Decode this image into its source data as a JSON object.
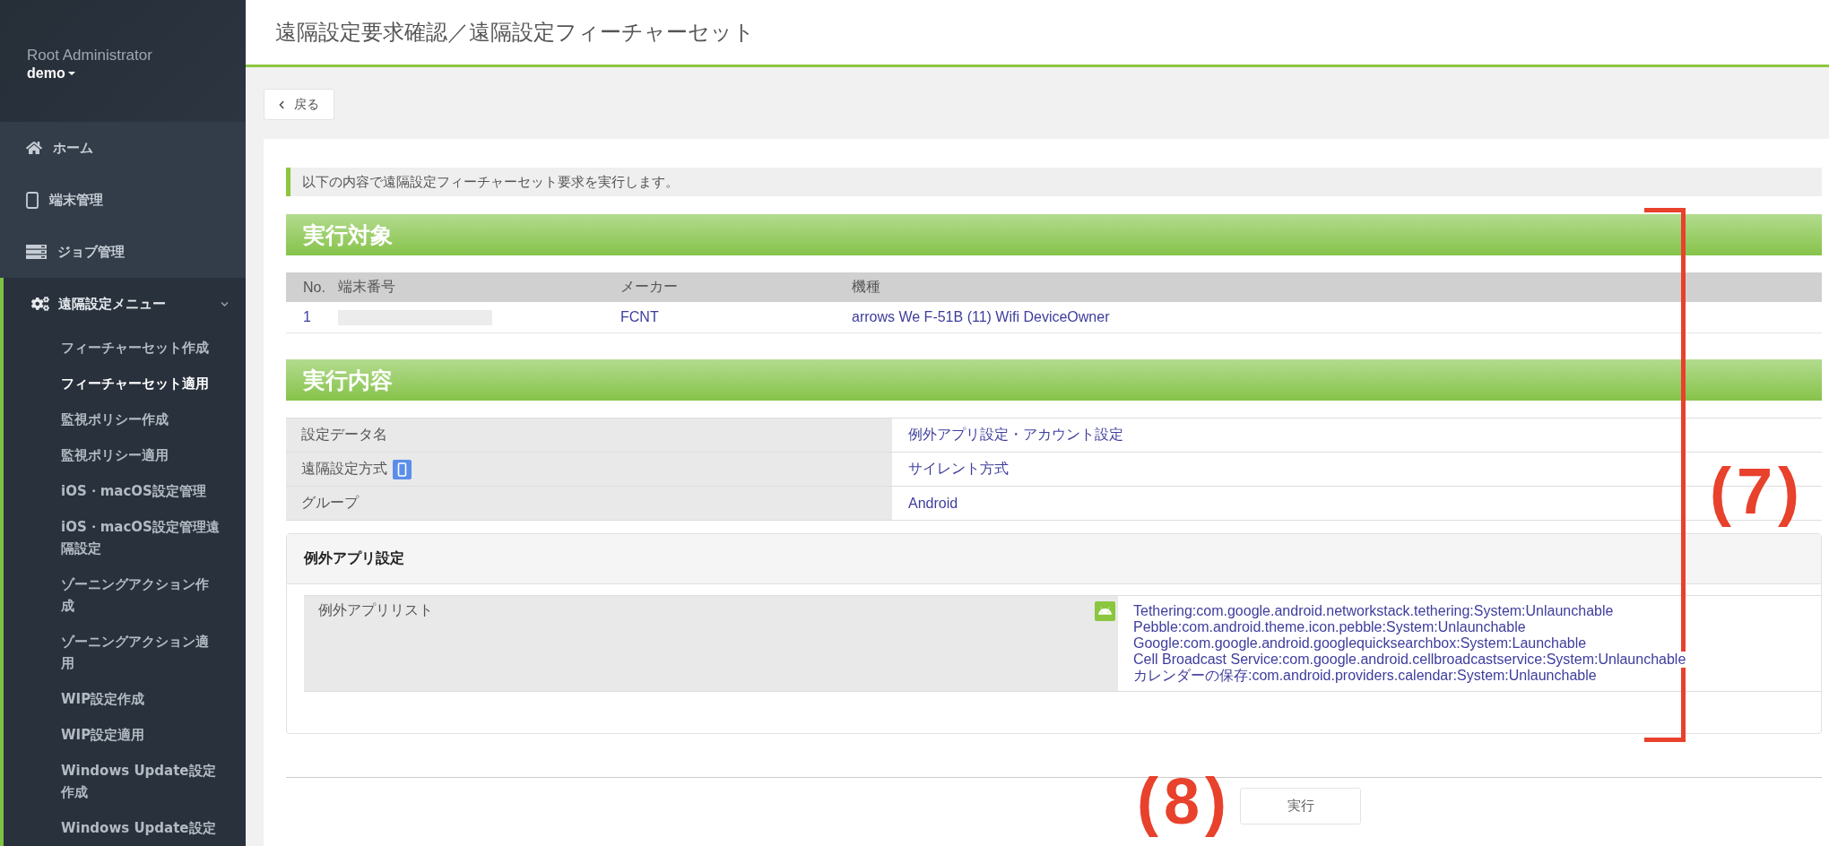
{
  "sidebar": {
    "role": "Root Administrator",
    "user": "demo",
    "items": [
      {
        "label": "ホーム",
        "selected": false
      },
      {
        "label": "端末管理",
        "selected": false
      },
      {
        "label": "ジョブ管理",
        "selected": false
      },
      {
        "label": "遠隔設定メニュー",
        "selected": true,
        "expanded": true,
        "children": [
          {
            "label": "フィーチャーセット作成",
            "selected": false
          },
          {
            "label": "フィーチャーセット適用",
            "selected": true
          },
          {
            "label": "監視ポリシー作成",
            "selected": false
          },
          {
            "label": "監視ポリシー適用",
            "selected": false
          },
          {
            "label": "iOS・macOS設定管理",
            "selected": false
          },
          {
            "label": "iOS・macOS設定管理遠隔設定",
            "selected": false
          },
          {
            "label": "ゾーニングアクション作成",
            "selected": false
          },
          {
            "label": "ゾーニングアクション適用",
            "selected": false
          },
          {
            "label": "WIP設定作成",
            "selected": false
          },
          {
            "label": "WIP設定適用",
            "selected": false
          },
          {
            "label": "Windows Update設定作成",
            "selected": false
          },
          {
            "label": "Windows Update設定",
            "selected": false
          }
        ]
      }
    ]
  },
  "header": {
    "title": "遠隔設定要求確認／遠隔設定フィーチャーセット"
  },
  "toolbar": {
    "back_button": "戻る"
  },
  "notice": "以下の内容で遠隔設定フィーチャーセット要求を実行します。",
  "target_section": {
    "heading": "実行対象",
    "columns": [
      "No.",
      "端末番号",
      "メーカー",
      "機種"
    ],
    "rows": [
      {
        "no": "1",
        "device_number_redacted": true,
        "maker": "FCNT",
        "model": "arrows We F-51B (11) Wifi DeviceOwner"
      }
    ]
  },
  "content_section": {
    "heading": "実行内容",
    "rows": [
      {
        "label": "設定データ名",
        "value": "例外アプリ設定・アカウント設定",
        "kind": "plain"
      },
      {
        "label": "遠隔設定方式",
        "value": "サイレント方式",
        "kind": "device"
      },
      {
        "label": "グループ",
        "value": "Android",
        "kind": "plain"
      }
    ],
    "settings_card": {
      "title": "例外アプリ設定",
      "rows": [
        {
          "label": "例外アプリリスト",
          "kind": "android",
          "values": [
            "Tethering:com.google.android.networkstack.tethering:System:Unlaunchable",
            "Pebble:com.android.theme.icon.pebble:System:Unlaunchable",
            "Google:com.google.android.googlequicksearchbox:System:Launchable",
            "Cell Broadcast Service:com.google.android.cellbroadcastservice:System:Unlaunchable",
            "カレンダーの保存:com.android.providers.calendar:System:Unlaunchable"
          ]
        }
      ]
    }
  },
  "execute_button": "実行",
  "annotations": [
    {
      "kind": "bracket",
      "label": "(7)"
    },
    {
      "kind": "marker",
      "label": "(8)"
    }
  ]
}
